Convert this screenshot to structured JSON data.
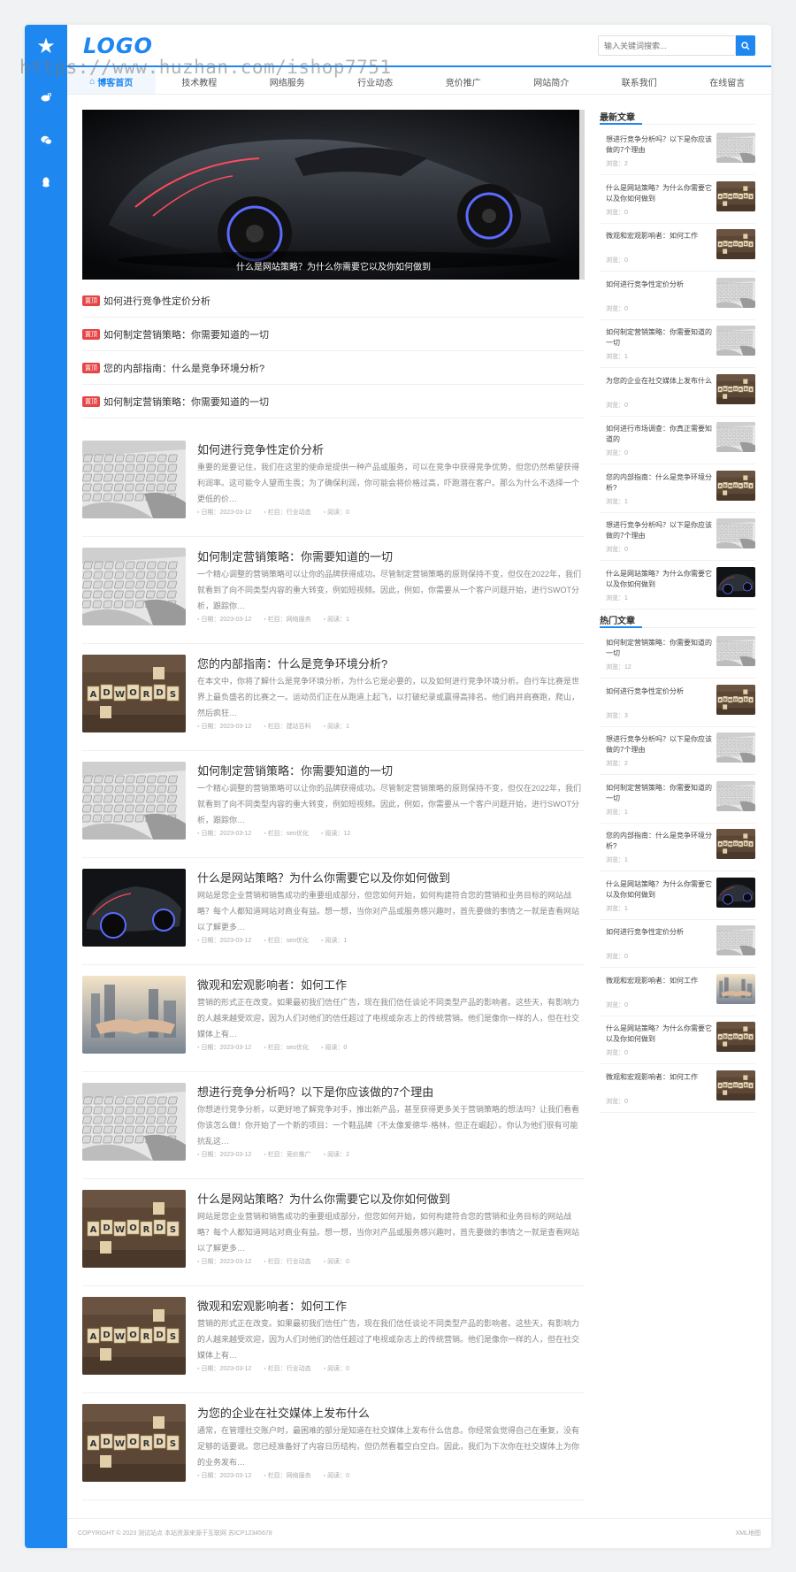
{
  "watermark": "https://www.huzhan.com/ishop7751",
  "logo": "LOGO",
  "search": {
    "placeholder": "输入关键词搜索..."
  },
  "nav": [
    "博客首页",
    "技术教程",
    "网络服务",
    "行业动态",
    "竞价推广",
    "网站简介",
    "联系我们",
    "在线留言"
  ],
  "banner": {
    "caption": "什么是网站策略？为什么你需要它以及你如何做到"
  },
  "notices": {
    "tag": "置顶",
    "items": [
      "如何进行竞争性定价分析",
      "如何制定营销策略：你需要知道的一切",
      "您的内部指南：什么是竞争环境分析?",
      "如何制定营销策略：你需要知道的一切"
    ]
  },
  "meta_labels": {
    "date": "日期：",
    "column": "栏目：",
    "views": "阅读："
  },
  "posts": [
    {
      "title": "如何进行竞争性定价分析",
      "desc": "重要的是要记住，我们在这里的使命是提供一种产品或服务，可以在竞争中获得竞争优势，但您仍然希望获得利润率。这可能令人望而生畏；为了确保利润，你可能会将价格过高，吓跑潜在客户。那么为什么不选择一个更低的价…",
      "date": "2023-03-12",
      "column": "行业动态",
      "views": "0",
      "img": "laptop"
    },
    {
      "title": "如何制定营销策略：你需要知道的一切",
      "desc": "一个精心调整的营销策略可以让你的品牌获得成功。尽管制定营销策略的原则保持不变，但仅在2022年，我们就看到了向不同类型内容的重大转变，例如短视频。因此，例如，你需要从一个客户问题开始，进行SWOT分析，跟踪你…",
      "date": "2023-03-12",
      "column": "网络服务",
      "views": "1",
      "img": "laptop"
    },
    {
      "title": "您的内部指南：什么是竞争环境分析?",
      "desc": "在本文中，你将了解什么是竞争环境分析，为什么它是必要的，以及如何进行竞争环境分析。自行车比赛是世界上最负盛名的比赛之一。运动员们正在从跑道上起飞，以打破纪录或赢得高排名。他们肩并肩赛跑，爬山，然后疯狂…",
      "date": "2023-03-12",
      "column": "建站百科",
      "views": "1",
      "img": "adwords"
    },
    {
      "title": "如何制定营销策略：你需要知道的一切",
      "desc": "一个精心调整的营销策略可以让你的品牌获得成功。尽管制定营销策略的原则保持不变，但仅在2022年，我们就看到了向不同类型内容的重大转变，例如短视频。因此，例如，你需要从一个客户问题开始，进行SWOT分析，跟踪你…",
      "date": "2023-03-12",
      "column": "seo优化",
      "views": "12",
      "img": "laptop"
    },
    {
      "title": "什么是网站策略？为什么你需要它以及你如何做到",
      "desc": "网站是您企业营销和销售成功的重要组成部分，但您如何开始，如何构建符合您的营销和业务目标的网站战略？每个人都知道网站对商业有益。想一想，当你对产品或服务感兴趣时，首先要做的事情之一就是查看网站以了解更多…",
      "date": "2023-03-12",
      "column": "seo优化",
      "views": "1",
      "img": "car"
    },
    {
      "title": "微观和宏观影响者：如何工作",
      "desc": "营销的形式正在改变。如果最初我们信任广告，现在我们信任谈论不同类型产品的影响者。这些天，有影响力的人越来越受欢迎，因为人们对他们的信任超过了电视或杂志上的传统营销。他们是像你一样的人，但在社交媒体上有…",
      "date": "2023-03-12",
      "column": "seo优化",
      "views": "0",
      "img": "handshake"
    },
    {
      "title": "想进行竞争分析吗？以下是你应该做的7个理由",
      "desc": "你想进行竞争分析，以更好地了解竞争对手，推出新产品，甚至获得更多关于营销策略的想法吗？让我们看看你该怎么做！你开始了一个新的项目：一个鞋品牌（不太像爱德华·格林，但正在崛起）。你认为他们很有可能抗乱这…",
      "date": "2023-03-12",
      "column": "竞价推广",
      "views": "2",
      "img": "laptop"
    },
    {
      "title": "什么是网站策略？为什么你需要它以及你如何做到",
      "desc": "网站是您企业营销和销售成功的重要组成部分，但您如何开始，如何构建符合您的营销和业务目标的网站战略？每个人都知道网站对商业有益。想一想，当你对产品或服务感兴趣时，首先要做的事情之一就是查看网站以了解更多…",
      "date": "2023-03-12",
      "column": "行业动态",
      "views": "0",
      "img": "adwords"
    },
    {
      "title": "微观和宏观影响者：如何工作",
      "desc": "营销的形式正在改变。如果最初我们信任广告，现在我们信任谈论不同类型产品的影响者。这些天，有影响力的人越来越受欢迎，因为人们对他们的信任超过了电视或杂志上的传统营销。他们是像你一样的人，但在社交媒体上有…",
      "date": "2023-03-12",
      "column": "行业动态",
      "views": "0",
      "img": "adwords"
    },
    {
      "title": "为您的企业在社交媒体上发布什么",
      "desc": "通常，在管理社交账户时，最困难的部分是知道在社交媒体上发布什么信息。你经常会觉得自己在重复，没有足够的话要说。您已经准备好了内容日历结构，但仍然看着空白空白。因此，我们为下次你在社交媒体上为你的业务发布…",
      "date": "2023-03-12",
      "column": "网络服务",
      "views": "0",
      "img": "adwords"
    }
  ],
  "sidebar": {
    "latest_title": "最新文章",
    "hot_title": "热门文章",
    "views_label": "浏览：",
    "latest": [
      {
        "title": "想进行竞争分析吗？以下是你应该做的7个理由",
        "views": "2",
        "img": "laptop"
      },
      {
        "title": "什么是网站策略？为什么你需要它以及你如何做到",
        "views": "0",
        "img": "adwords"
      },
      {
        "title": "微观和宏观影响者：如何工作",
        "views": "0",
        "img": "adwords"
      },
      {
        "title": "如何进行竞争性定价分析",
        "views": "0",
        "img": "laptop"
      },
      {
        "title": "如何制定营销策略：你需要知道的一切",
        "views": "1",
        "img": "laptop"
      },
      {
        "title": "为您的企业在社交媒体上发布什么",
        "views": "0",
        "img": "adwords"
      },
      {
        "title": "如何进行市场调查：你真正需要知道的",
        "views": "0",
        "img": "laptop"
      },
      {
        "title": "您的内部指南：什么是竞争环境分析?",
        "views": "1",
        "img": "adwords"
      },
      {
        "title": "想进行竞争分析吗？以下是你应该做的7个理由",
        "views": "0",
        "img": "laptop"
      },
      {
        "title": "什么是网站策略？为什么你需要它以及你如何做到",
        "views": "1",
        "img": "car"
      }
    ],
    "hot": [
      {
        "title": "如何制定营销策略：你需要知道的一切",
        "views": "12",
        "img": "laptop"
      },
      {
        "title": "如何进行竞争性定价分析",
        "views": "3",
        "img": "adwords"
      },
      {
        "title": "想进行竞争分析吗？以下是你应该做的7个理由",
        "views": "2",
        "img": "laptop"
      },
      {
        "title": "如何制定营销策略：你需要知道的一切",
        "views": "1",
        "img": "laptop"
      },
      {
        "title": "您的内部指南：什么是竞争环境分析?",
        "views": "1",
        "img": "adwords"
      },
      {
        "title": "什么是网站策略？为什么你需要它以及你如何做到",
        "views": "1",
        "img": "car"
      },
      {
        "title": "如何进行竞争性定价分析",
        "views": "0",
        "img": "laptop"
      },
      {
        "title": "微观和宏观影响者：如何工作",
        "views": "0",
        "img": "handshake"
      },
      {
        "title": "什么是网站策略？为什么你需要它以及你如何做到",
        "views": "0",
        "img": "adwords"
      },
      {
        "title": "微观和宏观影响者：如何工作",
        "views": "0",
        "img": "adwords"
      }
    ]
  },
  "footer": {
    "copyright": "COPYRIGHT © 2023 测试站点 本站资源来源于互联网 苏ICP12345678",
    "xml": "XML地图"
  },
  "colors": {
    "accent": "#1e87f0",
    "tag": "#e64545"
  },
  "icons": [
    "star-icon",
    "weibo-icon",
    "wechat-icon",
    "qq-icon",
    "search-icon"
  ]
}
